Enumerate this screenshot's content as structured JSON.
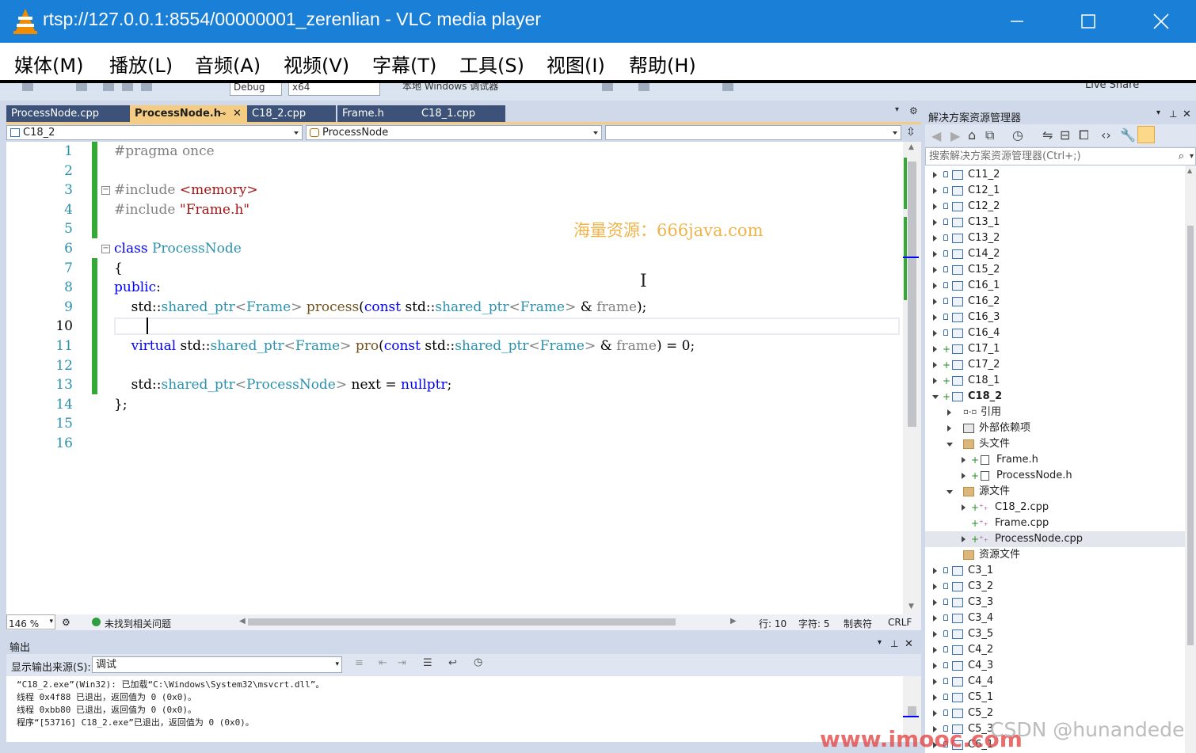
{
  "window": {
    "title": "rtsp://127.0.0.1:8554/00000001_zerenlian - VLC media player"
  },
  "vlc_menu": [
    "媒体(M)",
    "播放(L)",
    "音频(A)",
    "视频(V)",
    "字幕(T)",
    "工具(S)",
    "视图(I)",
    "帮助(H)"
  ],
  "vs_toolbar": {
    "config": "Debug",
    "platform": "x64",
    "debugger": "本地 Windows 调试器",
    "live_share": "Live Share"
  },
  "editor_tabs": [
    "ProcessNode.cpp",
    "ProcessNode.h",
    "C18_2.cpp",
    "Frame.h",
    "C18_1.cpp"
  ],
  "active_tab": "ProcessNode.h",
  "nav": {
    "project": "C18_2",
    "scope": "ProcessNode"
  },
  "code_lines": [
    "#pragma once",
    "",
    "#include <memory>",
    "#include \"Frame.h\"",
    "",
    "class ProcessNode",
    "{",
    "public:",
    "    std::shared_ptr<Frame> process(const std::shared_ptr<Frame> & frame);",
    "    ",
    "    virtual std::shared_ptr<Frame> pro(const std::shared_ptr<Frame> & frame) = 0;",
    "",
    "    std::shared_ptr<ProcessNode> next = nullptr;",
    "};",
    "",
    ""
  ],
  "line_numbers": [
    "1",
    "2",
    "3",
    "4",
    "5",
    "6",
    "7",
    "8",
    "9",
    "10",
    "11",
    "12",
    "13",
    "14",
    "15",
    "16"
  ],
  "watermark": "海量资源：666java.com",
  "editor_status": {
    "zoom": "146 %",
    "issues": "未找到相关问题",
    "line": "行: 10",
    "char": "字符: 5",
    "tabs": "制表符",
    "eol": "CRLF"
  },
  "output": {
    "title": "输出",
    "source_label": "显示输出来源(S):",
    "source_value": "调试",
    "lines": [
      "“C18_2.exe”(Win32): 已加载“C:\\Windows\\System32\\msvcrt.dll”。",
      "线程 0x4f88 已退出，返回值为 0 (0x0)。",
      "线程 0xbb80 已退出，返回值为 0 (0x0)。",
      "程序“[53716] C18_2.exe”已退出，返回值为 0 (0x0)。"
    ]
  },
  "solution_explorer": {
    "title": "解决方案资源管理器",
    "search_placeholder": "搜索解决方案资源管理器(Ctrl+;)",
    "nodes": [
      {
        "label": "C11_2"
      },
      {
        "label": "C12_1"
      },
      {
        "label": "C12_2"
      },
      {
        "label": "C13_1"
      },
      {
        "label": "C13_2"
      },
      {
        "label": "C14_2"
      },
      {
        "label": "C15_2"
      },
      {
        "label": "C16_1"
      },
      {
        "label": "C16_2"
      },
      {
        "label": "C16_3"
      },
      {
        "label": "C16_4"
      },
      {
        "label": "C17_1"
      },
      {
        "label": "C17_2"
      },
      {
        "label": "C18_1"
      },
      {
        "label": "C18_2"
      },
      {
        "label": "引用"
      },
      {
        "label": "外部依赖项"
      },
      {
        "label": "头文件"
      },
      {
        "label": "Frame.h"
      },
      {
        "label": "ProcessNode.h"
      },
      {
        "label": "源文件"
      },
      {
        "label": "C18_2.cpp"
      },
      {
        "label": "Frame.cpp"
      },
      {
        "label": "ProcessNode.cpp"
      },
      {
        "label": "资源文件"
      },
      {
        "label": "C3_1"
      },
      {
        "label": "C3_2"
      },
      {
        "label": "C3_3"
      },
      {
        "label": "C3_4"
      },
      {
        "label": "C3_5"
      },
      {
        "label": "C4_2"
      },
      {
        "label": "C4_3"
      },
      {
        "label": "C4_4"
      },
      {
        "label": "C5_1"
      },
      {
        "label": "C5_2"
      },
      {
        "label": "C5_3"
      },
      {
        "label": "C6_1"
      }
    ]
  },
  "bottom_watermark": "www.imooc.com",
  "csdn_watermark": "CSDN @hunandede",
  "colors": {
    "vlc_title": "#1a7fd6",
    "vs_bg": "#cfd9ea",
    "tab_active": "#f5cc84",
    "tab_inactive": "#3d5278",
    "change_bar": "#35a935"
  }
}
